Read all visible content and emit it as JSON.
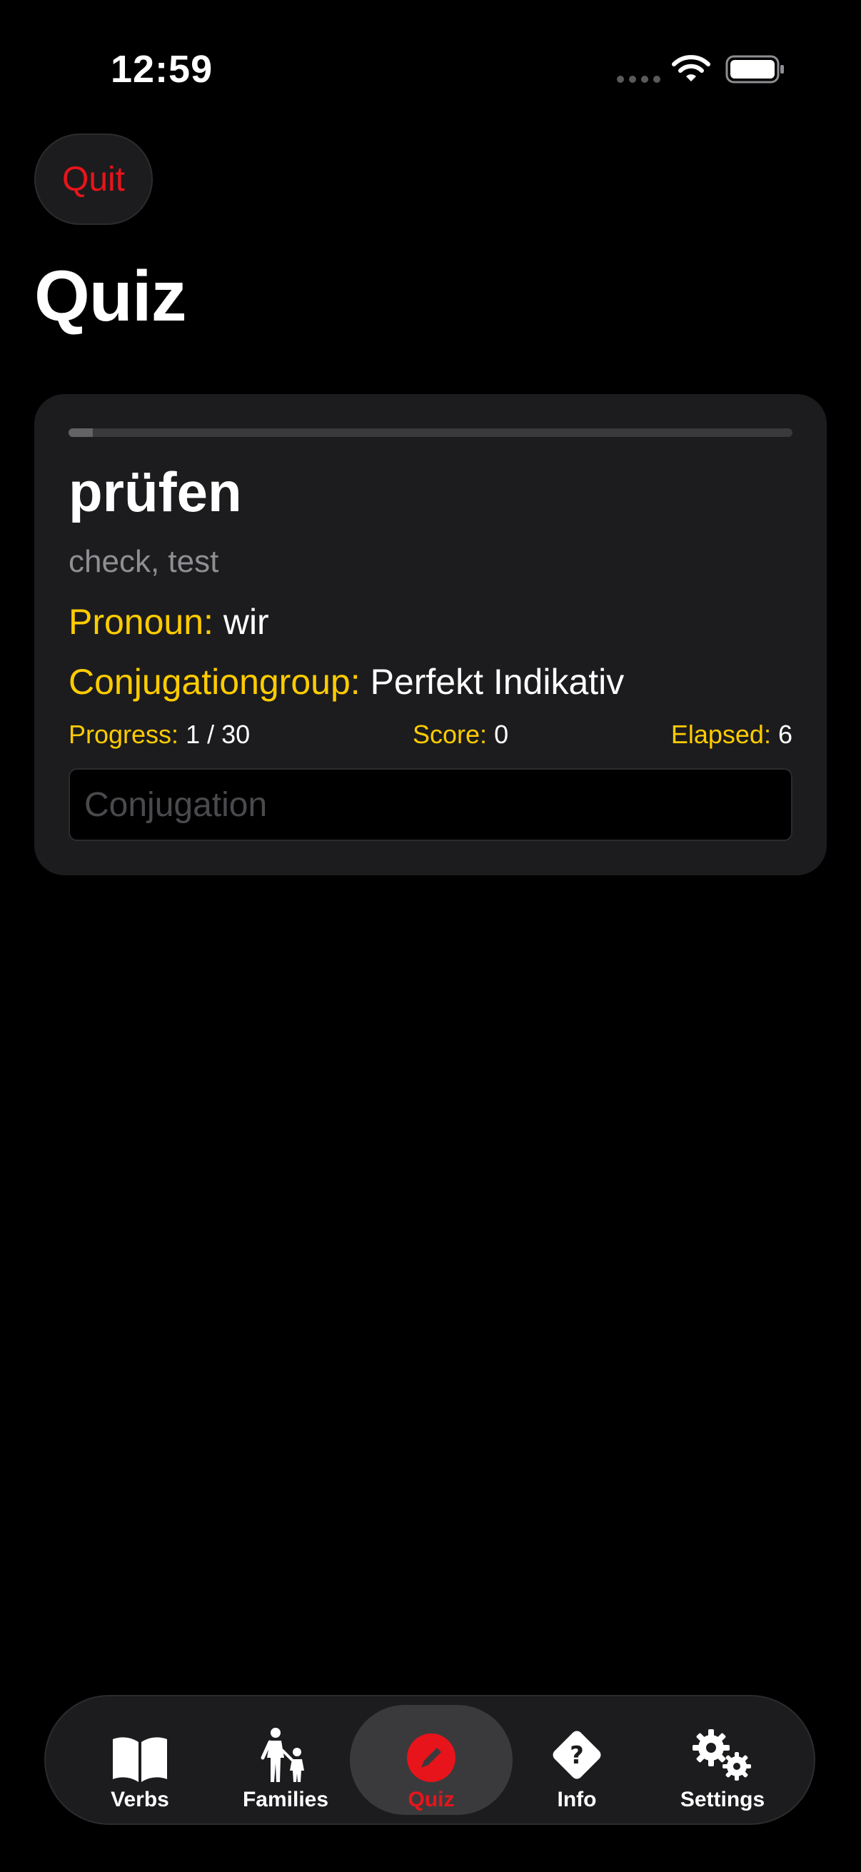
{
  "status_bar": {
    "time": "12:59"
  },
  "header": {
    "quit_label": "Quit",
    "title": "Quiz"
  },
  "quiz": {
    "progress_fraction": 0.0333,
    "verb": "prüfen",
    "translation": "check, test",
    "pronoun_label": "Pronoun:",
    "pronoun_value": "wir",
    "group_label": "Conjugationgroup:",
    "group_value": "Perfekt Indikativ",
    "progress_label": "Progress:",
    "progress_value": "1 / 30",
    "score_label": "Score:",
    "score_value": "0",
    "elapsed_label": "Elapsed:",
    "elapsed_value": "6",
    "input_placeholder": "Conjugation",
    "input_value": ""
  },
  "tabbar": {
    "items": [
      {
        "label": "Verbs",
        "icon": "book-icon"
      },
      {
        "label": "Families",
        "icon": "family-icon"
      },
      {
        "label": "Quiz",
        "icon": "pencil-circle-icon"
      },
      {
        "label": "Info",
        "icon": "question-diamond-icon"
      },
      {
        "label": "Settings",
        "icon": "gears-icon"
      }
    ],
    "active_index": 2
  },
  "colors": {
    "accent_red": "#e8141b",
    "label_yellow": "#ffcc00",
    "background": "#000000",
    "card": "#1c1c1e"
  }
}
